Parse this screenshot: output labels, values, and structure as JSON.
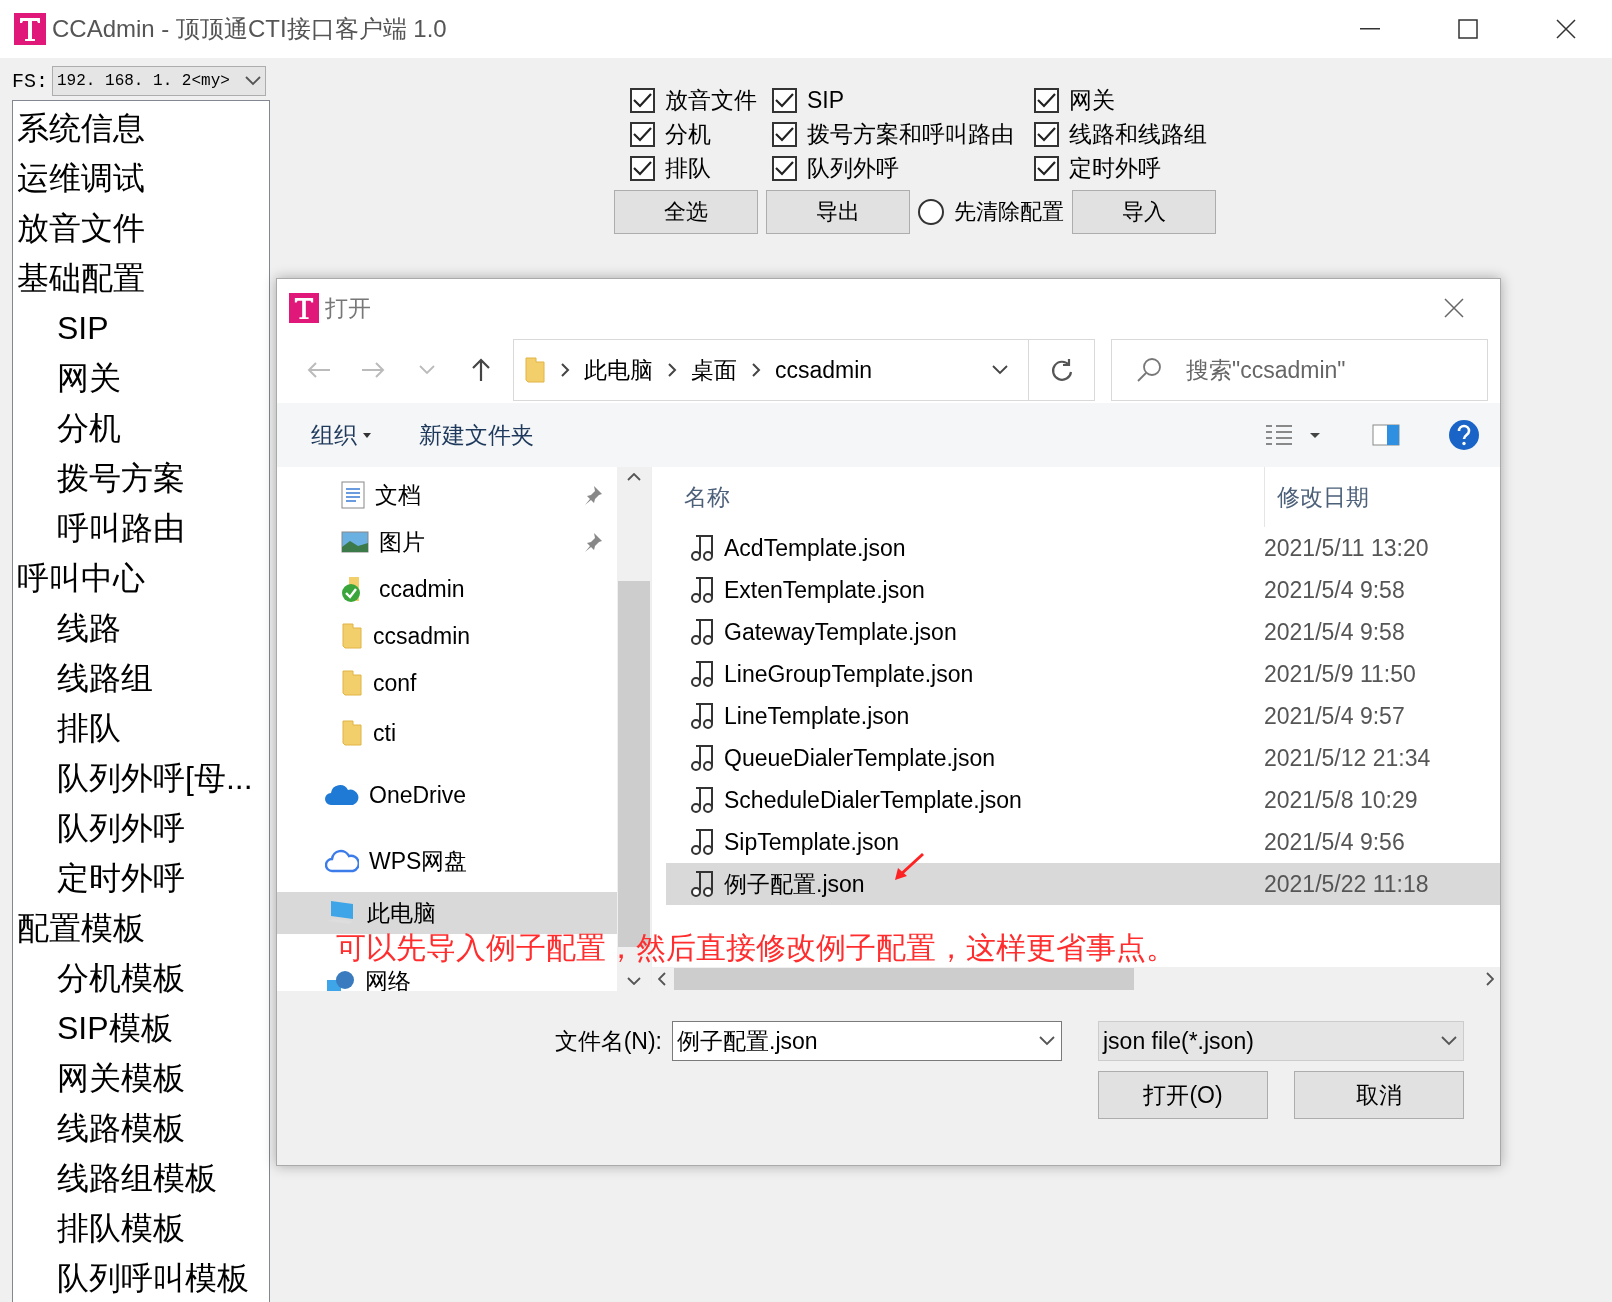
{
  "window": {
    "title": "CCAdmin - 顶顶通CTI接口客户端 1.0"
  },
  "fs": {
    "label": "FS:",
    "value": "192. 168. 1. 2<my>"
  },
  "sidebar": {
    "items": [
      {
        "label": "系统信息",
        "selected": false
      },
      {
        "label": "运维调试",
        "selected": false
      },
      {
        "label": "放音文件",
        "selected": false
      },
      {
        "label": "基础配置",
        "selected": false,
        "children": [
          {
            "label": "SIP",
            "selected": false
          },
          {
            "label": "网关",
            "selected": false
          },
          {
            "label": "分机",
            "selected": false
          },
          {
            "label": "拨号方案",
            "selected": false
          },
          {
            "label": "呼叫路由",
            "selected": false
          }
        ]
      },
      {
        "label": "呼叫中心",
        "selected": false,
        "children": [
          {
            "label": "线路",
            "selected": false
          },
          {
            "label": "线路组",
            "selected": false
          },
          {
            "label": "排队",
            "selected": false
          },
          {
            "label": "队列外呼[母...",
            "selected": false
          },
          {
            "label": "队列外呼",
            "selected": false
          },
          {
            "label": "定时外呼",
            "selected": false
          }
        ]
      },
      {
        "label": "配置模板",
        "selected": false,
        "children": [
          {
            "label": "分机模板",
            "selected": false
          },
          {
            "label": "SIP模板",
            "selected": false
          },
          {
            "label": "网关模板",
            "selected": false
          },
          {
            "label": "线路模板",
            "selected": false
          },
          {
            "label": "线路组模板",
            "selected": false
          },
          {
            "label": "排队模板",
            "selected": false
          },
          {
            "label": "队列呼叫模板",
            "selected": false
          }
        ]
      }
    ]
  },
  "export_options": [
    {
      "label": "放音文件",
      "checked": true
    },
    {
      "label": "SIP",
      "checked": true
    },
    {
      "label": "网关",
      "checked": true
    },
    {
      "label": "分机",
      "checked": true
    },
    {
      "label": "拨号方案和呼叫路由",
      "checked": true
    },
    {
      "label": "线路和线路组",
      "checked": true
    },
    {
      "label": "排队",
      "checked": true
    },
    {
      "label": "队列外呼",
      "checked": true
    },
    {
      "label": "定时外呼",
      "checked": true
    }
  ],
  "actions": {
    "select_all": "全选",
    "export": "导出",
    "clear_first": {
      "label": "先清除配置",
      "selected": false
    },
    "import": "导入"
  },
  "dialog": {
    "title": "打开",
    "breadcrumb": [
      "此电脑",
      "桌面",
      "ccsadmin"
    ],
    "search": {
      "placeholder": "搜索\"ccsadmin\""
    },
    "toolbar": {
      "organize": "组织",
      "new_folder": "新建文件夹"
    },
    "nav": [
      {
        "label": "文档",
        "kind": "document",
        "pinned": true,
        "selected": false
      },
      {
        "label": "图片",
        "kind": "picture",
        "pinned": true,
        "selected": false
      },
      {
        "label": "ccadmin",
        "kind": "synced-folder",
        "pinned": false,
        "selected": false
      },
      {
        "label": "ccsadmin",
        "kind": "folder",
        "pinned": false,
        "selected": false
      },
      {
        "label": "conf",
        "kind": "folder",
        "pinned": false,
        "selected": false
      },
      {
        "label": "cti",
        "kind": "folder",
        "pinned": false,
        "selected": false
      },
      {
        "label": "OneDrive",
        "kind": "cloud",
        "pinned": false,
        "selected": false
      },
      {
        "label": "WPS网盘",
        "kind": "cloud-outline",
        "pinned": false,
        "selected": false
      },
      {
        "label": "此电脑",
        "kind": "computer",
        "pinned": false,
        "selected": true
      },
      {
        "label": "网络",
        "kind": "network",
        "pinned": false,
        "selected": false
      }
    ],
    "columns": [
      "名称",
      "修改日期"
    ],
    "files": [
      {
        "name": "AcdTemplate.json",
        "date": "2021/5/11 13:20",
        "selected": false
      },
      {
        "name": "ExtenTemplate.json",
        "date": "2021/5/4 9:58",
        "selected": false
      },
      {
        "name": "GatewayTemplate.json",
        "date": "2021/5/4 9:58",
        "selected": false
      },
      {
        "name": "LineGroupTemplate.json",
        "date": "2021/5/9 11:50",
        "selected": false
      },
      {
        "name": "LineTemplate.json",
        "date": "2021/5/4 9:57",
        "selected": false
      },
      {
        "name": "QueueDialerTemplate.json",
        "date": "2021/5/12 21:34",
        "selected": false
      },
      {
        "name": "ScheduleDialerTemplate.json",
        "date": "2021/5/8 10:29",
        "selected": false
      },
      {
        "name": "SipTemplate.json",
        "date": "2021/5/4 9:56",
        "selected": false
      },
      {
        "name": "例子配置.json",
        "date": "2021/5/22 11:18",
        "selected": true
      }
    ],
    "filename_label": "文件名(N):",
    "filename": "例子配置.json",
    "filter": "json file(*.json)",
    "open": "打开(O)",
    "cancel": "取消"
  },
  "annotation": "可以先导入例子配置，然后直接修改例子配置，这样更省事点。"
}
